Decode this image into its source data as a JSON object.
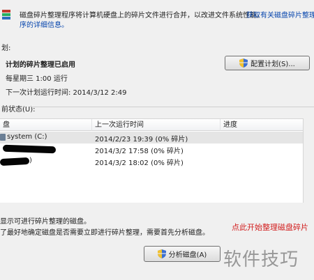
{
  "header": {
    "icon": "defrag-app-icon",
    "description": "磁盘碎片整理程序将计算机硬盘上的碎片文件进行合并，以改进文件系统性能。",
    "help_link_part1": "获取有关磁盘碎片整理",
    "help_link_part2": "序的详细信息。"
  },
  "schedule": {
    "section_title": "划:",
    "status": "计划的碎片整理已启用",
    "day_time": "每星期三  1:00 运行",
    "next_run": "下一次计划运行时间: 2014/3/12 2:49",
    "config_button": "配置计划(S)..."
  },
  "current_status": {
    "label": "前状态(U):",
    "columns": [
      "盘",
      "上一次运行时间",
      "进度"
    ],
    "rows": [
      {
        "disk": "system (C:)",
        "last_run": "2014/2/23 19:39 (0% 碎片)",
        "progress": ""
      },
      {
        "disk": "",
        "last_run": "2014/3/2 17:58 (0% 碎片)",
        "progress": ""
      },
      {
        "disk": ")",
        "last_run": "2014/3/2 18:02 (0% 碎片)",
        "progress": ""
      }
    ]
  },
  "footer": {
    "line1": "显示可进行碎片整理的磁盘。",
    "line2": "了最好地确定磁盘是否需要立即进行碎片整理，需要首先分析磁盘。",
    "annotation": "点此开始整理磁盘碎片",
    "analyze_button": "分析磁盘(A)",
    "watermark": "软件技巧"
  },
  "colors": {
    "link": "#0645ad",
    "annotation": "#d22020",
    "selected_row": "#e5e5e5"
  }
}
